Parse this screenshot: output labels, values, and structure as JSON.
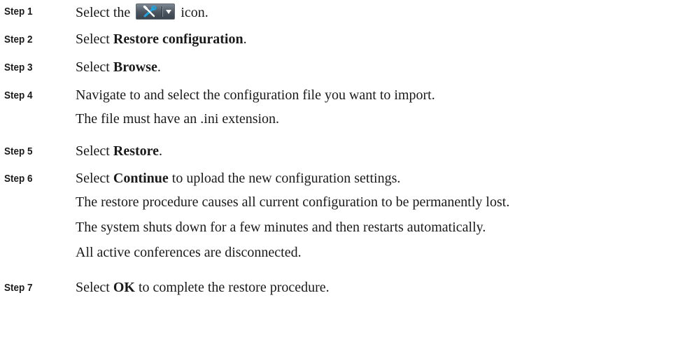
{
  "steps": [
    {
      "label": "Step 1",
      "pre": "Select the ",
      "post": "icon."
    },
    {
      "label": "Step 2",
      "pre": "Select ",
      "bold": "Restore configuration",
      "post": "."
    },
    {
      "label": "Step 3",
      "pre": "Select ",
      "bold": "Browse",
      "post": "."
    },
    {
      "label": "Step 4",
      "text": "Navigate to and select the configuration file you want to import.",
      "notes": [
        "The file must have an .ini extension."
      ]
    },
    {
      "label": "Step 5",
      "pre": "Select ",
      "bold": "Restore",
      "post": "."
    },
    {
      "label": "Step 6",
      "pre": "Select ",
      "bold": "Continue",
      "post": " to upload the new configuration settings.",
      "notes": [
        "The restore procedure causes all current configuration to be permanently lost.",
        "The system shuts down for a few minutes and then restarts automatically.",
        "All active conferences are disconnected."
      ]
    },
    {
      "label": "Step 7",
      "pre": "Select ",
      "bold": "OK",
      "post": " to complete the restore procedure."
    }
  ],
  "icons": {
    "tool_button": "tools-menu-icon"
  },
  "colors": {
    "text": "#1a1a1a",
    "button_bg": "#4b5560",
    "wrench": "#1fa3e0"
  }
}
